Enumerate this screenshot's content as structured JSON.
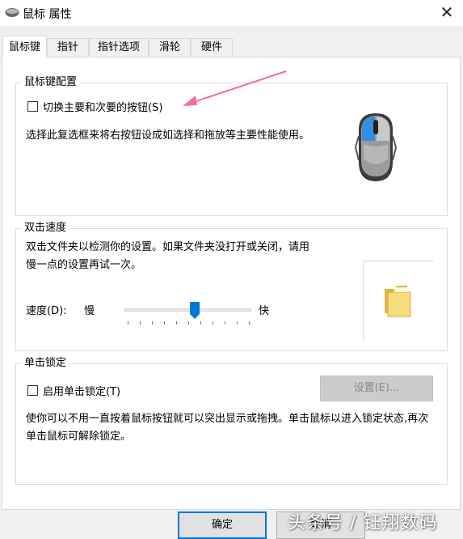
{
  "window": {
    "title": "鼠标 属性",
    "close_symbol": "✕"
  },
  "tabs": [
    {
      "label": "鼠标键",
      "active": true
    },
    {
      "label": "指针"
    },
    {
      "label": "指针选项"
    },
    {
      "label": "滑轮"
    },
    {
      "label": "硬件"
    }
  ],
  "button_config": {
    "legend": "鼠标键配置",
    "switch_label": "切换主要和次要的按钮(S)",
    "switch_checked": false,
    "description": "选择此复选框来将右按钮设成如选择和拖放等主要性能使用。"
  },
  "double_click": {
    "legend": "双击速度",
    "description": "双击文件夹以检测你的设置。如果文件夹没打开或关闭，请用慢一点的设置再试一次。",
    "speed_label": "速度(D):",
    "slow_label": "慢",
    "fast_label": "快",
    "speed_fraction": 0.55
  },
  "click_lock": {
    "legend": "单击锁定",
    "checkbox_label": "启用单击锁定(T)",
    "checked": false,
    "settings_button": "设置(E)...",
    "description": "使你可以不用一直按着鼠标按钮就可以突出显示或拖拽。单击鼠标以进入锁定状态,再次单击鼠标可解除锁定。"
  },
  "footer": {
    "ok_label": "确定",
    "cancel_label": "取消"
  },
  "watermark": "头条号 / 钰翔数码",
  "colors": {
    "accent": "#0078d7",
    "mouse_highlight": "#2f8fe0",
    "annotation_arrow": "#f06e9c"
  }
}
